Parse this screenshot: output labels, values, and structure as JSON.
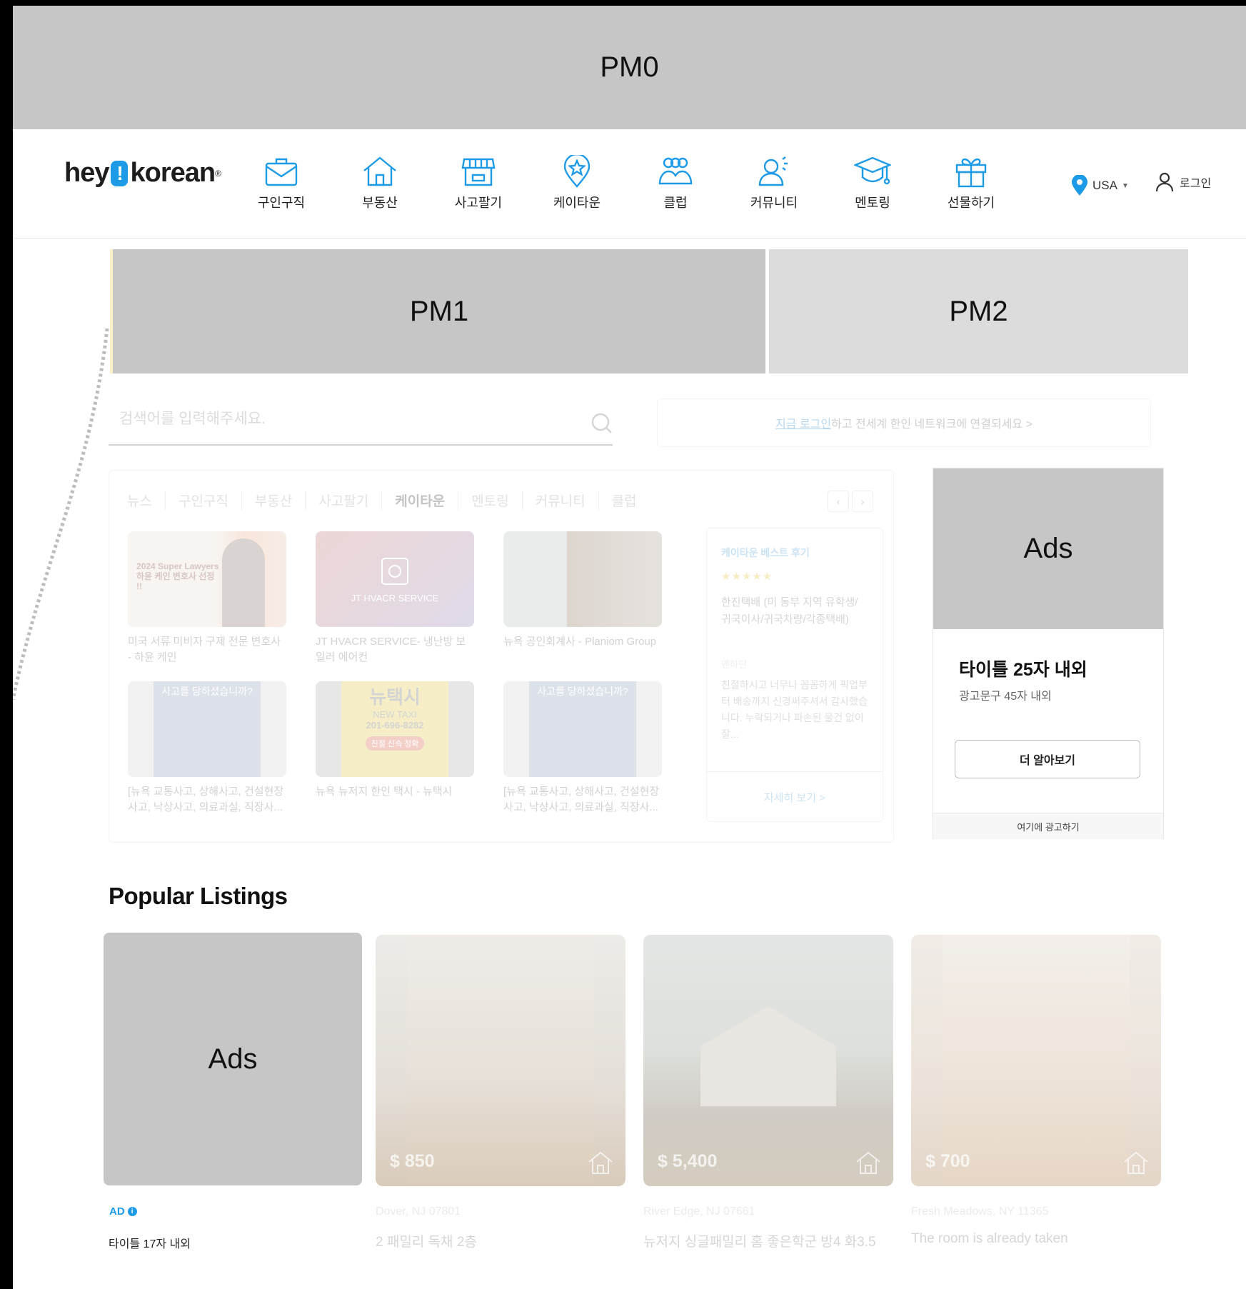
{
  "placeholders": {
    "pm0": "PM0",
    "pm1": "PM1",
    "pm2": "PM2",
    "ads_side": "Ads",
    "ads_listing": "Ads"
  },
  "header": {
    "logo_left": "hey",
    "logo_bang": "!",
    "logo_right": "korean",
    "logo_reg": "®",
    "nav": [
      {
        "label": "구인구직",
        "icon": "job-envelope-icon"
      },
      {
        "label": "부동산",
        "icon": "house-icon"
      },
      {
        "label": "사고팔기",
        "icon": "store-icon"
      },
      {
        "label": "케이타운",
        "icon": "location-star-icon"
      },
      {
        "label": "클럽",
        "icon": "group-icon"
      },
      {
        "label": "커뮤니티",
        "icon": "community-user-icon"
      },
      {
        "label": "멘토링",
        "icon": "graduation-cap-icon"
      },
      {
        "label": "선물하기",
        "icon": "gift-icon"
      }
    ],
    "location": "USA",
    "login": "로그인"
  },
  "search": {
    "placeholder": "검색어를 입력해주세요."
  },
  "promo": {
    "link": "지금 로그인",
    "text": "하고 전세계 한인 네트워크에 연결되세요 >"
  },
  "tabs": [
    "뉴스",
    "구인구직",
    "부동산",
    "사고팔기",
    "케이타운",
    "멘토링",
    "커뮤니티",
    "클럽"
  ],
  "active_tab": "케이타운",
  "cards": [
    {
      "caption": "미국 서류 미비자 구제 전문 변호사 - 하윤 케인",
      "img_text": "2024 Super Lawyers 하윤 케인 변호사 선정 !!"
    },
    {
      "caption": "JT HVACR SERVICE- 냉난방 보일러 에어컨",
      "img_text": "JT HVACR SERVICE"
    },
    {
      "caption": "뉴욕 공인회계사 - Planiom Group",
      "img_text": ""
    },
    {
      "caption": "[뉴욕 교통사고, 상해사고, 건설현장 사고, 낙상사고, 의료과실, 직장사...",
      "img_text": "사고를 당하셨습니까?"
    },
    {
      "caption": "뉴욕 뉴저지 한인 택시 - 뉴택시",
      "img_text": "뉴택시",
      "img_sub": "NEW TAXI",
      "phone": "201-696-8282",
      "badge": "친절 신속 정확"
    },
    {
      "caption": "[뉴욕 교통사고, 상해사고, 건설현장 사고, 낙상사고, 의료과실, 직장사...",
      "img_text": "사고를 당하셨습니까?"
    }
  ],
  "review": {
    "heading": "케이타운 베스트 후기",
    "stars": "★★★★★",
    "title": "한진택배 (미 동부 지역 유학생/귀국이사/귀국차량/각종택배)",
    "author": "멘하딘",
    "body": "친절하시고 너무나 꼼꼼하게 픽업부터 배송까지 신경써주셔서 감사했습니다. 누락되거나 파손된 물건 없이 잘...",
    "more": "자세히 보기 >"
  },
  "side_ad": {
    "title": "타이틀 25자 내외",
    "desc": "광고문구 45자 내외",
    "button": "더 알아보기",
    "footer": "여기에 광고하기"
  },
  "popular": {
    "title": "Popular Listings",
    "ad_badge": "AD",
    "ad_title": "타이틀 17자 내외",
    "listings": [
      {
        "price": "$ 850",
        "location": "Dover, NJ 07801",
        "title": "2 패밀리 독채 2층"
      },
      {
        "price": "$ 5,400",
        "location": "River Edge, NJ 07661",
        "title": "뉴저지 싱글패밀리 홈 좋은학군 방4 화3.5"
      },
      {
        "price": "$ 700",
        "location": "Fresh Meadows, NY 11365",
        "title": "The room is already taken"
      }
    ]
  },
  "colors": {
    "brand_blue": "#1e9be6",
    "placeholder_gray": "#c6c6c6"
  }
}
